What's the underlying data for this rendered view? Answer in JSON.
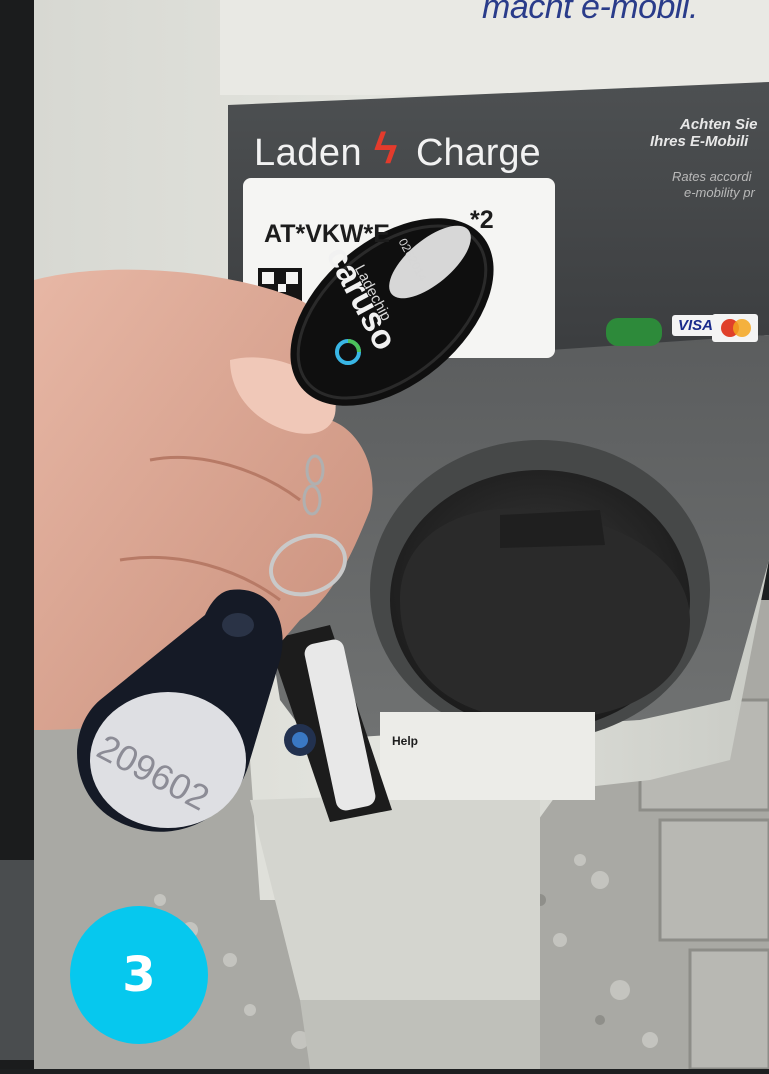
{
  "scene": {
    "slogan": "macht e-mobil.",
    "station": {
      "label_laden": "Laden",
      "label_charge": "Charge",
      "station_id_prefix": "AT*VKW*E",
      "station_id_suffix": "*2",
      "notice_line1": "Achten Sie",
      "notice_line2": "Ihres E-Mobili",
      "notice_line3": "Rates accordi",
      "notice_line4": "e-mobility pr",
      "payment_card": "VISA",
      "help_label": "Help"
    },
    "keyfob": {
      "brand": "caruso",
      "subtitle": "Ladechip",
      "chip_number": "0262014"
    },
    "rfid_tag_number": "209602"
  },
  "step_badge": {
    "number": "3",
    "color": "#06c8ee"
  }
}
